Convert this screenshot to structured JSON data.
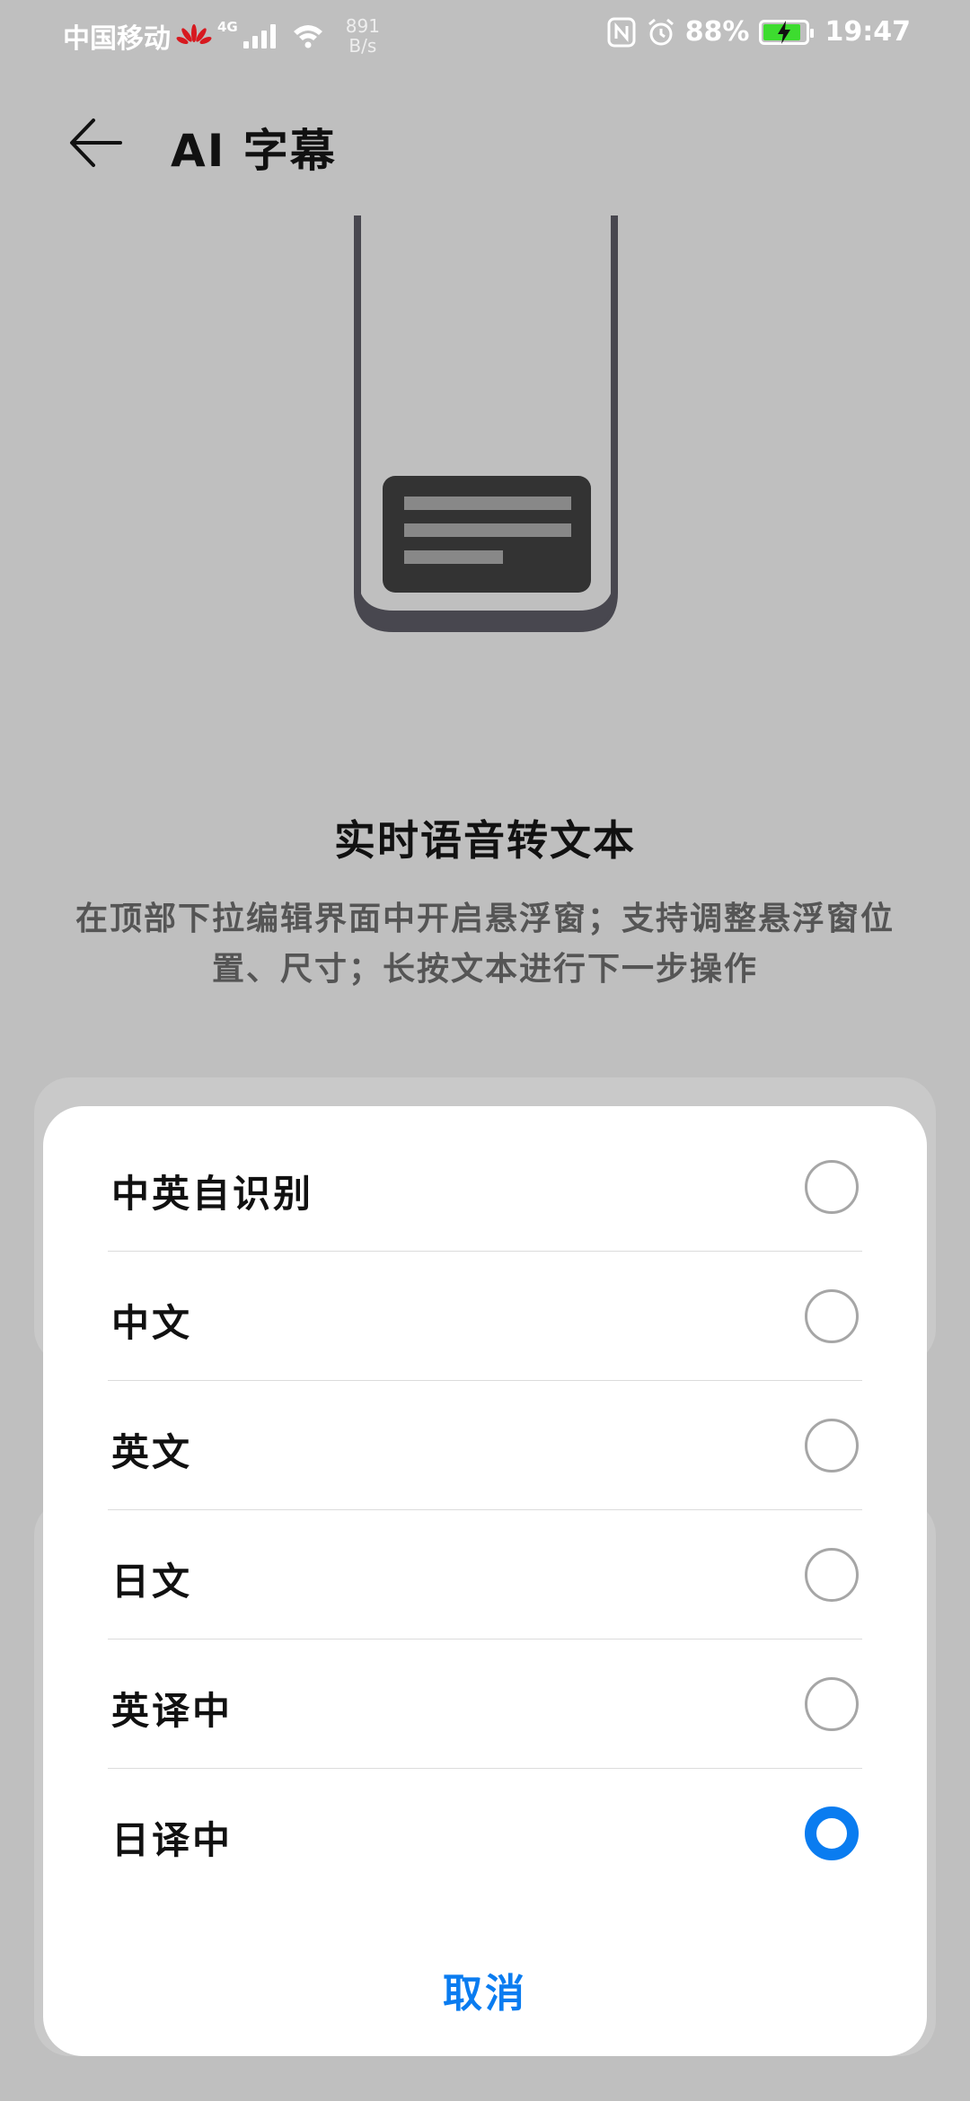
{
  "status_bar": {
    "carrier": "中国移动",
    "network_type": "4G",
    "speed_value": "891",
    "speed_unit": "B/s",
    "battery_percent": "88%",
    "time": "19:47",
    "battery_color": "#3ddc2f"
  },
  "header": {
    "title": "AI 字幕",
    "back_icon": "arrow-left-icon"
  },
  "feature": {
    "title": "实时语音转文本",
    "description": "在顶部下拉编辑界面中开启悬浮窗；支持调整悬浮窗位置、尺寸；长按文本进行下一步操作"
  },
  "dialog": {
    "options": [
      {
        "label": "中英自识别",
        "selected": false
      },
      {
        "label": "中文",
        "selected": false
      },
      {
        "label": "英文",
        "selected": false
      },
      {
        "label": "日文",
        "selected": false
      },
      {
        "label": "英译中",
        "selected": false
      },
      {
        "label": "日译中",
        "selected": true
      }
    ],
    "cancel_label": "取消",
    "accent_color": "#0a7cf0"
  }
}
